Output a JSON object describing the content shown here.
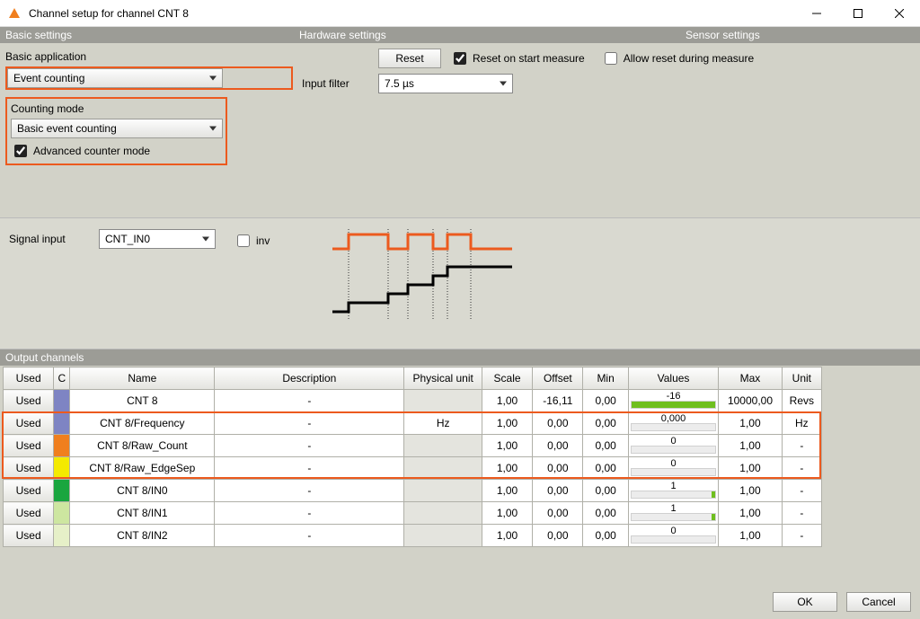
{
  "title": "Channel setup for channel CNT 8",
  "sections": {
    "basic": "Basic settings",
    "hardware": "Hardware settings",
    "sensor": "Sensor settings",
    "output": "Output channels"
  },
  "basic": {
    "application_label": "Basic application",
    "application_value": "Event counting",
    "counting_mode_label": "Counting mode",
    "counting_mode_value": "Basic event counting",
    "advanced_label": "Advanced counter mode",
    "advanced_checked": true
  },
  "hardware": {
    "reset_button": "Reset",
    "reset_on_start_label": "Reset on start measure",
    "reset_on_start_checked": true,
    "allow_reset_label": "Allow reset during measure",
    "allow_reset_checked": false,
    "input_filter_label": "Input filter",
    "input_filter_value": "7.5 µs"
  },
  "signal": {
    "label": "Signal input",
    "value": "CNT_IN0",
    "inv_label": "inv",
    "inv_checked": false
  },
  "table": {
    "headers": [
      "Used",
      "C",
      "Name",
      "Description",
      "Physical unit",
      "Scale",
      "Offset",
      "Min",
      "Values",
      "Max",
      "Unit"
    ],
    "rows": [
      {
        "used": "Used",
        "color": "#7e84c3",
        "name": "CNT 8",
        "desc": "-",
        "phys": "",
        "phys_grey": true,
        "scale": "1,00",
        "offset": "-16,11",
        "min": "0,00",
        "value": "-16",
        "bar_l": 0,
        "bar_r": 100,
        "max": "10000,00",
        "unit": "Revs",
        "highlight": false
      },
      {
        "used": "Used",
        "color": "#7e84c3",
        "name": "CNT 8/Frequency",
        "desc": "-",
        "phys": "Hz",
        "phys_grey": false,
        "scale": "1,00",
        "offset": "0,00",
        "min": "0,00",
        "value": "0,000",
        "bar_l": 0,
        "bar_r": 0,
        "max": "1,00",
        "unit": "Hz",
        "highlight": true
      },
      {
        "used": "Used",
        "color": "#f07f1e",
        "name": "CNT 8/Raw_Count",
        "desc": "-",
        "phys": "",
        "phys_grey": true,
        "scale": "1,00",
        "offset": "0,00",
        "min": "0,00",
        "value": "0",
        "bar_l": 0,
        "bar_r": 0,
        "max": "1,00",
        "unit": "-",
        "highlight": true
      },
      {
        "used": "Used",
        "color": "#f4ea00",
        "name": "CNT 8/Raw_EdgeSep",
        "desc": "-",
        "phys": "",
        "phys_grey": true,
        "scale": "1,00",
        "offset": "0,00",
        "min": "0,00",
        "value": "0",
        "bar_l": 0,
        "bar_r": 0,
        "max": "1,00",
        "unit": "-",
        "highlight": true
      },
      {
        "used": "Used",
        "color": "#1aa63f",
        "name": "CNT 8/IN0",
        "desc": "-",
        "phys": "",
        "phys_grey": true,
        "scale": "1,00",
        "offset": "0,00",
        "min": "0,00",
        "value": "1",
        "bar_l": 100,
        "bar_r": 100,
        "max": "1,00",
        "unit": "-",
        "highlight": false
      },
      {
        "used": "Used",
        "color": "#cde6a0",
        "name": "CNT 8/IN1",
        "desc": "-",
        "phys": "",
        "phys_grey": true,
        "scale": "1,00",
        "offset": "0,00",
        "min": "0,00",
        "value": "1",
        "bar_l": 100,
        "bar_r": 100,
        "max": "1,00",
        "unit": "-",
        "highlight": false
      },
      {
        "used": "Used",
        "color": "#e6f0c8",
        "name": "CNT 8/IN2",
        "desc": "-",
        "phys": "",
        "phys_grey": true,
        "scale": "1,00",
        "offset": "0,00",
        "min": "0,00",
        "value": "0",
        "bar_l": 0,
        "bar_r": 0,
        "max": "1,00",
        "unit": "-",
        "highlight": false
      }
    ]
  },
  "footer": {
    "ok": "OK",
    "cancel": "Cancel"
  }
}
